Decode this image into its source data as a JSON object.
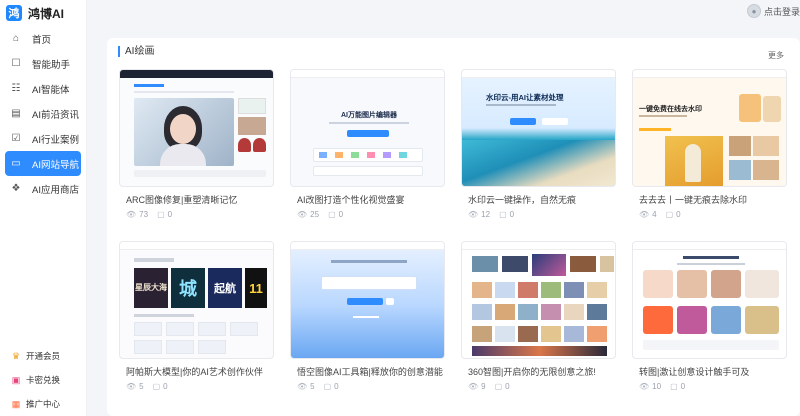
{
  "app": {
    "name": "鸿博AI",
    "logo_char": "鸿"
  },
  "header": {
    "user_label": "点击登录"
  },
  "sidebar": {
    "items": [
      {
        "label": "首页",
        "icon": "home-icon",
        "glyph": "⌂"
      },
      {
        "label": "智能助手",
        "icon": "chat-icon",
        "glyph": "☐"
      },
      {
        "label": "AI智能体",
        "icon": "agent-icon",
        "glyph": "☷"
      },
      {
        "label": "AI前沿资讯",
        "icon": "news-icon",
        "glyph": "▤"
      },
      {
        "label": "AI行业案例",
        "icon": "case-icon",
        "glyph": "☑"
      },
      {
        "label": "AI网站导航",
        "icon": "nav-icon",
        "glyph": "▭",
        "active": true
      },
      {
        "label": "AI应用商店",
        "icon": "store-icon",
        "glyph": "❖"
      }
    ],
    "bottom": [
      {
        "label": "开通会员",
        "icon": "vip-icon",
        "glyph": "♛",
        "color": "#f0a020"
      },
      {
        "label": "卡密兑换",
        "icon": "card-icon",
        "glyph": "▣",
        "color": "#e8457a"
      },
      {
        "label": "推广中心",
        "icon": "promo-icon",
        "glyph": "▦",
        "color": "#ff6a3d"
      }
    ]
  },
  "section": {
    "title": "AI绘画",
    "more": "更多"
  },
  "cards": [
    {
      "title": "ARC图像修复|重塑清晰记忆",
      "views": "73",
      "likes": "0"
    },
    {
      "title": "AI改图打造个性化视觉盛宴",
      "views": "25",
      "likes": "0"
    },
    {
      "title": "水印云一键操作，自然无痕",
      "views": "12",
      "likes": "0"
    },
    {
      "title": "去去去丨一键无痕去除水印",
      "views": "4",
      "likes": "0"
    },
    {
      "title": "阿帕斯大模型|你的AI艺术创作伙伴",
      "views": "5",
      "likes": "0"
    },
    {
      "title": "悟空图像AI工具箱|释放你的创意潜能",
      "views": "5",
      "likes": "0"
    },
    {
      "title": "360智图|开启你的无限创意之旅!",
      "views": "9",
      "likes": "0"
    },
    {
      "title": "转图|激让创意设计触手可及",
      "views": "10",
      "likes": "0"
    }
  ],
  "thumb_text": {
    "c2_title": "AI万能图片编辑器",
    "c3_title": "水印云-用AI让素材处理",
    "c4_title": "一键免费在线去水印",
    "c5_tiles": [
      "星辰大海",
      "城",
      "起航",
      "11"
    ]
  },
  "colors": {
    "accent": "#2f8cff"
  }
}
